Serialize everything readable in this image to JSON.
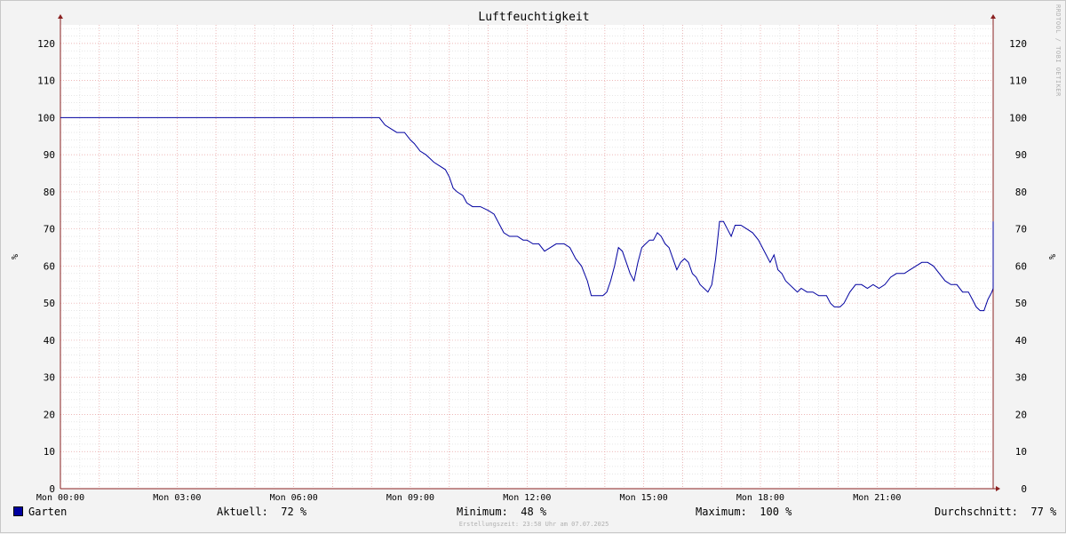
{
  "chart_data": {
    "type": "line",
    "title": "Luftfeuchtigkeit",
    "ylabel": "%",
    "ylim": [
      0,
      125
    ],
    "y_ticks": [
      0,
      10,
      20,
      30,
      40,
      50,
      60,
      70,
      80,
      90,
      100,
      110,
      120
    ],
    "x_range_hours": [
      0,
      24
    ],
    "x_ticks": [
      {
        "h": 0,
        "label": "Mon 00:00"
      },
      {
        "h": 3,
        "label": "Mon 03:00"
      },
      {
        "h": 6,
        "label": "Mon 06:00"
      },
      {
        "h": 9,
        "label": "Mon 09:00"
      },
      {
        "h": 12,
        "label": "Mon 12:00"
      },
      {
        "h": 15,
        "label": "Mon 15:00"
      },
      {
        "h": 18,
        "label": "Mon 18:00"
      },
      {
        "h": 21,
        "label": "Mon 21:00"
      }
    ],
    "grid": true,
    "series": [
      {
        "name": "Garten",
        "color": "#0000a0",
        "points": [
          [
            0,
            100
          ],
          [
            8.2,
            100
          ],
          [
            8.35,
            98
          ],
          [
            8.5,
            97
          ],
          [
            8.65,
            96
          ],
          [
            8.85,
            96
          ],
          [
            9.0,
            94
          ],
          [
            9.1,
            93
          ],
          [
            9.25,
            91
          ],
          [
            9.4,
            90
          ],
          [
            9.5,
            89
          ],
          [
            9.6,
            88
          ],
          [
            9.75,
            87
          ],
          [
            9.9,
            86
          ],
          [
            10.0,
            84
          ],
          [
            10.1,
            81
          ],
          [
            10.2,
            80
          ],
          [
            10.35,
            79
          ],
          [
            10.45,
            77
          ],
          [
            10.6,
            76
          ],
          [
            10.8,
            76
          ],
          [
            11.0,
            75
          ],
          [
            11.15,
            74
          ],
          [
            11.3,
            71
          ],
          [
            11.4,
            69
          ],
          [
            11.55,
            68
          ],
          [
            11.75,
            68
          ],
          [
            11.9,
            67
          ],
          [
            12.0,
            67
          ],
          [
            12.15,
            66
          ],
          [
            12.3,
            66
          ],
          [
            12.45,
            64
          ],
          [
            12.6,
            65
          ],
          [
            12.75,
            66
          ],
          [
            12.95,
            66
          ],
          [
            13.1,
            65
          ],
          [
            13.25,
            62
          ],
          [
            13.4,
            60
          ],
          [
            13.55,
            56
          ],
          [
            13.65,
            52
          ],
          [
            13.8,
            52
          ],
          [
            13.95,
            52
          ],
          [
            14.05,
            53
          ],
          [
            14.15,
            56
          ],
          [
            14.25,
            60
          ],
          [
            14.35,
            65
          ],
          [
            14.45,
            64
          ],
          [
            14.55,
            61
          ],
          [
            14.65,
            58
          ],
          [
            14.75,
            56
          ],
          [
            14.85,
            61
          ],
          [
            14.95,
            65
          ],
          [
            15.05,
            66
          ],
          [
            15.15,
            67
          ],
          [
            15.25,
            67
          ],
          [
            15.35,
            69
          ],
          [
            15.45,
            68
          ],
          [
            15.55,
            66
          ],
          [
            15.65,
            65
          ],
          [
            15.75,
            62
          ],
          [
            15.85,
            59
          ],
          [
            15.95,
            61
          ],
          [
            16.05,
            62
          ],
          [
            16.15,
            61
          ],
          [
            16.25,
            58
          ],
          [
            16.35,
            57
          ],
          [
            16.45,
            55
          ],
          [
            16.55,
            54
          ],
          [
            16.65,
            53
          ],
          [
            16.75,
            55
          ],
          [
            16.85,
            62
          ],
          [
            16.95,
            72
          ],
          [
            17.05,
            72
          ],
          [
            17.15,
            70
          ],
          [
            17.25,
            68
          ],
          [
            17.35,
            71
          ],
          [
            17.5,
            71
          ],
          [
            17.65,
            70
          ],
          [
            17.8,
            69
          ],
          [
            17.95,
            67
          ],
          [
            18.05,
            65
          ],
          [
            18.15,
            63
          ],
          [
            18.25,
            61
          ],
          [
            18.35,
            63
          ],
          [
            18.45,
            59
          ],
          [
            18.55,
            58
          ],
          [
            18.65,
            56
          ],
          [
            18.75,
            55
          ],
          [
            18.85,
            54
          ],
          [
            18.95,
            53
          ],
          [
            19.05,
            54
          ],
          [
            19.2,
            53
          ],
          [
            19.35,
            53
          ],
          [
            19.5,
            52
          ],
          [
            19.7,
            52
          ],
          [
            19.8,
            50
          ],
          [
            19.9,
            49
          ],
          [
            20.05,
            49
          ],
          [
            20.15,
            50
          ],
          [
            20.3,
            53
          ],
          [
            20.45,
            55
          ],
          [
            20.6,
            55
          ],
          [
            20.75,
            54
          ],
          [
            20.9,
            55
          ],
          [
            21.05,
            54
          ],
          [
            21.2,
            55
          ],
          [
            21.35,
            57
          ],
          [
            21.5,
            58
          ],
          [
            21.7,
            58
          ],
          [
            21.85,
            59
          ],
          [
            22.0,
            60
          ],
          [
            22.15,
            61
          ],
          [
            22.3,
            61
          ],
          [
            22.45,
            60
          ],
          [
            22.6,
            58
          ],
          [
            22.75,
            56
          ],
          [
            22.9,
            55
          ],
          [
            23.05,
            55
          ],
          [
            23.2,
            53
          ],
          [
            23.35,
            53
          ],
          [
            23.45,
            51
          ],
          [
            23.55,
            49
          ],
          [
            23.65,
            48
          ],
          [
            23.75,
            48
          ],
          [
            23.85,
            51
          ],
          [
            23.95,
            53
          ],
          [
            24.05,
            54
          ],
          [
            24.2,
            56
          ],
          [
            24.35,
            57
          ],
          [
            24.5,
            58
          ],
          [
            24.6,
            59
          ],
          [
            24.75,
            60
          ],
          [
            25.0,
            60
          ],
          [
            25.5,
            60
          ],
          [
            25.75,
            59
          ],
          [
            26.0,
            59
          ],
          [
            26.2,
            60
          ],
          [
            26.4,
            61
          ],
          [
            26.6,
            62
          ],
          [
            26.8,
            63
          ],
          [
            27.0,
            64
          ],
          [
            27.3,
            65
          ],
          [
            27.6,
            66
          ],
          [
            27.9,
            67
          ],
          [
            28.1,
            68
          ],
          [
            28.35,
            69
          ],
          [
            28.55,
            70
          ],
          [
            28.75,
            71
          ],
          [
            29.0,
            72
          ],
          [
            29.1,
            71
          ],
          [
            29.3,
            70
          ],
          [
            29.6,
            70
          ],
          [
            29.85,
            71
          ],
          [
            30.0,
            72
          ],
          [
            30.2,
            72
          ]
        ]
      }
    ]
  },
  "legend": {
    "series_label": "Garten",
    "current_label": "Aktuell:",
    "current_value": "72 %",
    "min_label": "Minimum:",
    "min_value": "48 %",
    "max_label": "Maximum:",
    "max_value": "100 %",
    "avg_label": "Durchschnitt:",
    "avg_value": "77 %"
  },
  "side_text": "RRDTOOL / TOBI OETIKER",
  "footer_text": "Erstellungszeit: 23:58 Uhr am 07.07.2025"
}
